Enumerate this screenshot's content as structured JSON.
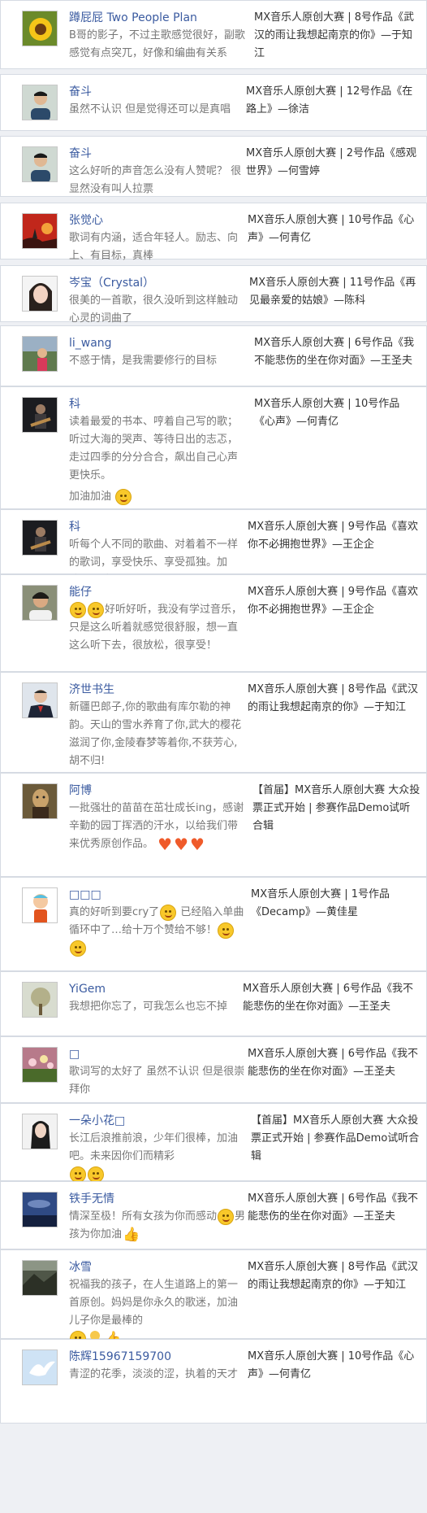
{
  "comments": [
    {
      "name": "蹲屁屁 Two People Plan",
      "avatar": "sunflower-avatar",
      "text": "B哥的影子，不过主歌感觉很好，副歌感觉有点突兀，好像和编曲有关系",
      "source": "MX音乐人原创大赛 | 8号作品《武汉的雨让我想起南京的你》—于知江"
    },
    {
      "name": "奋斗",
      "avatar": "young-man-avatar",
      "text": "虽然不认识 但是觉得还可以是真唱",
      "source": "MX音乐人原创大赛 | 12号作品《在路上》—徐洁"
    },
    {
      "name": "奋斗",
      "avatar": "young-man-avatar",
      "text": "这么好听的声音怎么没有人赞呢？ 很显然没有叫人拉票",
      "source": "MX音乐人原创大赛 | 2号作品《感观世界》—何雪婷"
    },
    {
      "name": "张觉心",
      "avatar": "sunset-avatar",
      "text": "歌词有内涵，适合年轻人。励志、向上、有目标，真棒",
      "source": "MX音乐人原创大赛 | 10号作品《心声》—何青亿"
    },
    {
      "name": "岑宝（Crystal）",
      "avatar": "girl-avatar",
      "text": "很美的一首歌，很久没听到这样触动心灵的词曲了",
      "source": "MX音乐人原创大赛 | 11号作品《再见最亲爱的姑娘》—陈科"
    },
    {
      "name": "li_wang",
      "avatar": "child-avatar",
      "text": "不惑于情，是我需要修行的目标",
      "source": "MX音乐人原创大赛 | 6号作品《我不能悲伤的坐在你对面》—王圣夫"
    },
    {
      "name": "科",
      "avatar": "guitarist-avatar",
      "text": "读着最爱的书本、哼着自己写的歌；听过大海的哭声、等待日出的志忑，走过四季的分分合合，飙出自己心声更快乐。",
      "text2": "加油加油",
      "source": "MX音乐人原创大赛 | 10号作品《心声》—何青亿"
    },
    {
      "name": "科",
      "avatar": "guitarist-avatar",
      "text": "听每个人不同的歌曲、对着着不一样的歌词，享受快乐、享受孤独。加油、加油！",
      "source": "MX音乐人原创大赛 | 9号作品《喜欢你不必拥抱世界》—王企企"
    },
    {
      "name": "能仔",
      "avatar": "man-avatar",
      "text": "好听好听，我没有学过音乐，只是这么听着就感觉很舒服，想一直这么听下去，很放松，很享受！",
      "source": "MX音乐人原创大赛 | 9号作品《喜欢你不必拥抱世界》—王企企"
    },
    {
      "name": "济世书生",
      "avatar": "suit-man-avatar",
      "text": "新疆巴郎子,你的歌曲有库尔勒的神韵。天山的雪水养育了你,武大的樱花滋润了你,金陵春梦等着你,不获芳心,胡不归!",
      "source": "MX音乐人原创大赛 | 8号作品《武汉的雨让我想起南京的你》—于知江"
    },
    {
      "name": "阿博",
      "avatar": "painting-avatar",
      "text": "一批强壮的苗苗在茁壮成长ing，感谢辛勤的园丁挥洒的汗水，以给我们带来优秀原创作品。",
      "source": "【首届】MX音乐人原创大赛 大众投票正式开始 | 参赛作品Demo试听合辑"
    },
    {
      "name": "□□□",
      "avatar": "cartoon-avatar",
      "text": "真的好听到要cry了",
      "text2": "已经陷入单曲循环中了…给十万个赞给不够！",
      "source": "MX音乐人原创大赛 | 1号作品《Decamp》—黄佳星"
    },
    {
      "name": "YiGem",
      "avatar": "tree-avatar",
      "text": "我想把你忘了，可我怎么也忘不掉",
      "source": "MX音乐人原创大赛 | 6号作品《我不能悲伤的坐在你对面》—王圣夫"
    },
    {
      "name": "□",
      "avatar": "flowers-avatar",
      "text": "歌词写的太好了 虽然不认识 但是很崇拜你",
      "source": "MX音乐人原创大赛 | 6号作品《我不能悲伤的坐在你对面》—王圣夫"
    },
    {
      "name": "一朵小花□",
      "avatar": "woman-avatar",
      "text": "长江后浪推前浪，少年们很棒，加油吧。未来因你们而精彩",
      "source": "【首届】MX音乐人原创大赛 大众投票正式开始 | 参赛作品Demo试听合辑"
    },
    {
      "name": "铁手无情",
      "avatar": "sky-avatar",
      "text": "情深至极！所有女孩为你而感动",
      "text2": "男孩为你加油",
      "source": "MX音乐人原创大赛 | 6号作品《我不能悲伤的坐在你对面》—王圣夫"
    },
    {
      "name": "冰雪",
      "avatar": "landscape-avatar",
      "text": "祝福我的孩子，在人生道路上的第一首原创。妈妈是你永久的歌迷，加油儿子你是最棒的",
      "source": "MX音乐人原创大赛 | 8号作品《武汉的雨让我想起南京的你》—于知江"
    },
    {
      "name": "陈辉15967159700",
      "avatar": "bird-avatar",
      "text": "青涩的花季，淡淡的涩，执着的天才",
      "source": "MX音乐人原创大赛 | 10号作品《心声》—何青亿"
    }
  ]
}
